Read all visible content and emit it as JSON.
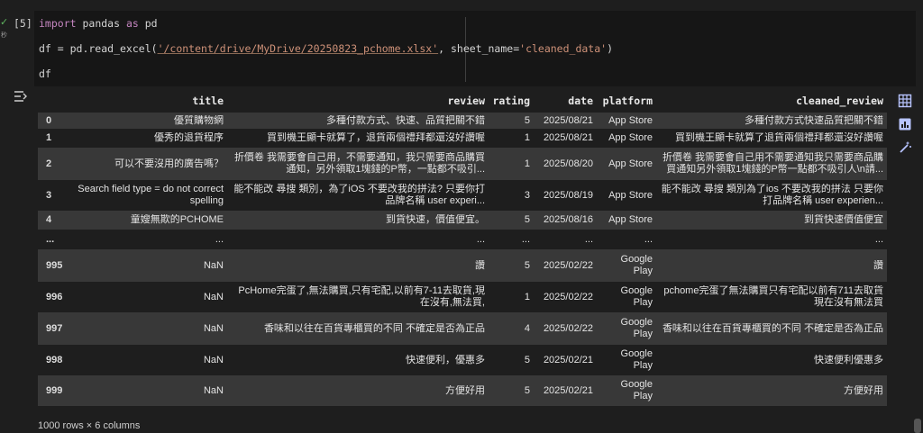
{
  "cell": {
    "exec_count": "[5]",
    "run_status_glyph": "✓",
    "run_time_text": "秒",
    "code": {
      "line1_kw1": "import",
      "line1_mid": " pandas ",
      "line1_kw2": "as",
      "line1_end": " pd",
      "line2_pre": "df = pd.read_excel(",
      "line2_path": "'/content/drive/MyDrive/20250823_pchome.xlsx'",
      "line2_mid": ", sheet_name=",
      "line2_sheet": "'cleaned_data'",
      "line2_end": ")",
      "line3": "df"
    }
  },
  "output": {
    "columns": [
      "",
      "title",
      "review",
      "rating",
      "date",
      "platform",
      "cleaned_review"
    ],
    "rows": [
      [
        "0",
        "優質購物網",
        "多種付款方式、快速、品質把關不錯",
        "5",
        "2025/08/21",
        "App Store",
        "多種付款方式快速品質把關不錯"
      ],
      [
        "1",
        "優秀的退貨程序",
        "買到機王顯卡就算了，退貨兩個禮拜都還沒好讚喔",
        "1",
        "2025/08/21",
        "App Store",
        "買到機王顯卡就算了退貨兩個禮拜都還沒好讚喔"
      ],
      [
        "2",
        "可以不要沒用的廣告嗎？",
        "折價卷 我需要會自己用，不需要通知，我只需要商品購買通知，另外領取1塊錢的P幣，一點都不吸引...",
        "1",
        "2025/08/20",
        "App Store",
        "折價卷 我需要會自己用不需要通知我只需要商品購買通知另外領取1塊錢的P幣一點都不吸引人\\n請..."
      ],
      [
        "3",
        "Search field type = do not correct spelling",
        "能不能改 尋搜 類別，為了iOS 不要改我的拼法? 只要你打品牌名稱 user experi...",
        "3",
        "2025/08/19",
        "App Store",
        "能不能改 尋搜 類別為了ios 不要改我的拼法 只要你打品牌名稱 user experien..."
      ],
      [
        "4",
        "童嫂無欺的PCHOME",
        "到貨快速，價值便宜。",
        "5",
        "2025/08/16",
        "App Store",
        "到貨快速價值便宜"
      ],
      [
        "...",
        "...",
        "...",
        "...",
        "...",
        "...",
        "..."
      ],
      [
        "995",
        "NaN",
        "讚",
        "5",
        "2025/02/22",
        "Google Play",
        "讚"
      ],
      [
        "996",
        "NaN",
        "PcHome完蛋了,無法購買,只有宅配,以前有7-11去取貨,現在沒有,無法買,",
        "1",
        "2025/02/22",
        "Google Play",
        "pchome完蛋了無法購買只有宅配以前有711去取貨現在沒有無法買"
      ],
      [
        "997",
        "NaN",
        "香味和以往在百貨專櫃買的不同 不確定是否為正品",
        "4",
        "2025/02/22",
        "Google Play",
        "香味和以往在百貨專櫃買的不同 不確定是否為正品"
      ],
      [
        "998",
        "NaN",
        "快速便利，優惠多",
        "5",
        "2025/02/21",
        "Google Play",
        "快速便利優惠多"
      ],
      [
        "999",
        "NaN",
        "方便好用",
        "5",
        "2025/02/21",
        "Google Play",
        "方便好用"
      ]
    ],
    "row_heights": [
      18,
      21,
      36,
      34,
      21,
      22,
      36,
      34,
      36,
      34,
      34
    ],
    "summary": "1000 rows × 6 columns"
  },
  "icons": {
    "output_menu": "output-menu-icon",
    "table": "table-view-icon",
    "chart": "bar-chart-icon",
    "magic": "magic-wand-icon"
  }
}
